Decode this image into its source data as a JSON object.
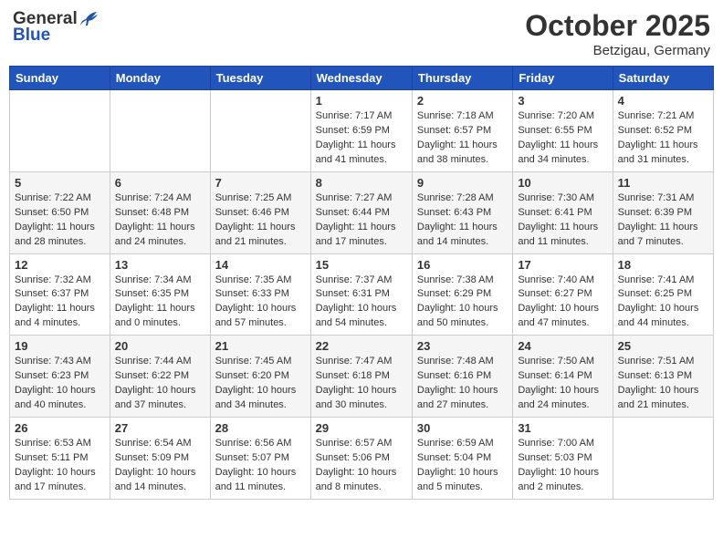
{
  "header": {
    "logo_general": "General",
    "logo_blue": "Blue",
    "month": "October 2025",
    "location": "Betzigau, Germany"
  },
  "weekdays": [
    "Sunday",
    "Monday",
    "Tuesday",
    "Wednesday",
    "Thursday",
    "Friday",
    "Saturday"
  ],
  "weeks": [
    [
      {
        "day": "",
        "info": ""
      },
      {
        "day": "",
        "info": ""
      },
      {
        "day": "",
        "info": ""
      },
      {
        "day": "1",
        "info": "Sunrise: 7:17 AM\nSunset: 6:59 PM\nDaylight: 11 hours\nand 41 minutes."
      },
      {
        "day": "2",
        "info": "Sunrise: 7:18 AM\nSunset: 6:57 PM\nDaylight: 11 hours\nand 38 minutes."
      },
      {
        "day": "3",
        "info": "Sunrise: 7:20 AM\nSunset: 6:55 PM\nDaylight: 11 hours\nand 34 minutes."
      },
      {
        "day": "4",
        "info": "Sunrise: 7:21 AM\nSunset: 6:52 PM\nDaylight: 11 hours\nand 31 minutes."
      }
    ],
    [
      {
        "day": "5",
        "info": "Sunrise: 7:22 AM\nSunset: 6:50 PM\nDaylight: 11 hours\nand 28 minutes."
      },
      {
        "day": "6",
        "info": "Sunrise: 7:24 AM\nSunset: 6:48 PM\nDaylight: 11 hours\nand 24 minutes."
      },
      {
        "day": "7",
        "info": "Sunrise: 7:25 AM\nSunset: 6:46 PM\nDaylight: 11 hours\nand 21 minutes."
      },
      {
        "day": "8",
        "info": "Sunrise: 7:27 AM\nSunset: 6:44 PM\nDaylight: 11 hours\nand 17 minutes."
      },
      {
        "day": "9",
        "info": "Sunrise: 7:28 AM\nSunset: 6:43 PM\nDaylight: 11 hours\nand 14 minutes."
      },
      {
        "day": "10",
        "info": "Sunrise: 7:30 AM\nSunset: 6:41 PM\nDaylight: 11 hours\nand 11 minutes."
      },
      {
        "day": "11",
        "info": "Sunrise: 7:31 AM\nSunset: 6:39 PM\nDaylight: 11 hours\nand 7 minutes."
      }
    ],
    [
      {
        "day": "12",
        "info": "Sunrise: 7:32 AM\nSunset: 6:37 PM\nDaylight: 11 hours\nand 4 minutes."
      },
      {
        "day": "13",
        "info": "Sunrise: 7:34 AM\nSunset: 6:35 PM\nDaylight: 11 hours\nand 0 minutes."
      },
      {
        "day": "14",
        "info": "Sunrise: 7:35 AM\nSunset: 6:33 PM\nDaylight: 10 hours\nand 57 minutes."
      },
      {
        "day": "15",
        "info": "Sunrise: 7:37 AM\nSunset: 6:31 PM\nDaylight: 10 hours\nand 54 minutes."
      },
      {
        "day": "16",
        "info": "Sunrise: 7:38 AM\nSunset: 6:29 PM\nDaylight: 10 hours\nand 50 minutes."
      },
      {
        "day": "17",
        "info": "Sunrise: 7:40 AM\nSunset: 6:27 PM\nDaylight: 10 hours\nand 47 minutes."
      },
      {
        "day": "18",
        "info": "Sunrise: 7:41 AM\nSunset: 6:25 PM\nDaylight: 10 hours\nand 44 minutes."
      }
    ],
    [
      {
        "day": "19",
        "info": "Sunrise: 7:43 AM\nSunset: 6:23 PM\nDaylight: 10 hours\nand 40 minutes."
      },
      {
        "day": "20",
        "info": "Sunrise: 7:44 AM\nSunset: 6:22 PM\nDaylight: 10 hours\nand 37 minutes."
      },
      {
        "day": "21",
        "info": "Sunrise: 7:45 AM\nSunset: 6:20 PM\nDaylight: 10 hours\nand 34 minutes."
      },
      {
        "day": "22",
        "info": "Sunrise: 7:47 AM\nSunset: 6:18 PM\nDaylight: 10 hours\nand 30 minutes."
      },
      {
        "day": "23",
        "info": "Sunrise: 7:48 AM\nSunset: 6:16 PM\nDaylight: 10 hours\nand 27 minutes."
      },
      {
        "day": "24",
        "info": "Sunrise: 7:50 AM\nSunset: 6:14 PM\nDaylight: 10 hours\nand 24 minutes."
      },
      {
        "day": "25",
        "info": "Sunrise: 7:51 AM\nSunset: 6:13 PM\nDaylight: 10 hours\nand 21 minutes."
      }
    ],
    [
      {
        "day": "26",
        "info": "Sunrise: 6:53 AM\nSunset: 5:11 PM\nDaylight: 10 hours\nand 17 minutes."
      },
      {
        "day": "27",
        "info": "Sunrise: 6:54 AM\nSunset: 5:09 PM\nDaylight: 10 hours\nand 14 minutes."
      },
      {
        "day": "28",
        "info": "Sunrise: 6:56 AM\nSunset: 5:07 PM\nDaylight: 10 hours\nand 11 minutes."
      },
      {
        "day": "29",
        "info": "Sunrise: 6:57 AM\nSunset: 5:06 PM\nDaylight: 10 hours\nand 8 minutes."
      },
      {
        "day": "30",
        "info": "Sunrise: 6:59 AM\nSunset: 5:04 PM\nDaylight: 10 hours\nand 5 minutes."
      },
      {
        "day": "31",
        "info": "Sunrise: 7:00 AM\nSunset: 5:03 PM\nDaylight: 10 hours\nand 2 minutes."
      },
      {
        "day": "",
        "info": ""
      }
    ]
  ]
}
